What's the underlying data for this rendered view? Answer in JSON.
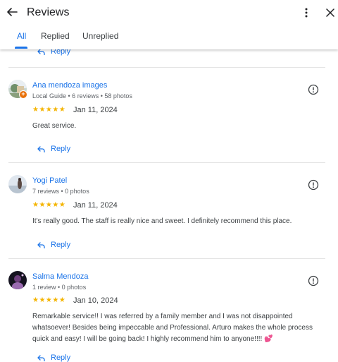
{
  "header": {
    "title": "Reviews",
    "back_icon": "arrow-back-icon",
    "more_icon": "more-vert-icon",
    "close_icon": "close-icon"
  },
  "tabs": [
    {
      "label": "All",
      "active": true
    },
    {
      "label": "Replied",
      "active": false
    },
    {
      "label": "Unreplied",
      "active": false
    }
  ],
  "colors": {
    "accent": "#1a73e8",
    "star": "#f4b400",
    "badge": "#e8710a"
  },
  "reply_label": "Reply",
  "reviews": [
    {
      "name": "Ana mendoza images",
      "meta": "Local Guide • 6 reviews • 58 photos",
      "stars": "★★★★★",
      "rating": 5,
      "date": "Jan 11, 2024",
      "text": "Great service.",
      "local_guide": true
    },
    {
      "name": "Yogi Patel",
      "meta": "7 reviews • 0 photos",
      "stars": "★★★★★",
      "rating": 5,
      "date": "Jan 11, 2024",
      "text": "It's really good. The staff is really nice and sweet. I definitely recommend this place."
    },
    {
      "name": "Salma Mendoza",
      "meta": "1 review • 0 photos",
      "stars": "★★★★★",
      "rating": 5,
      "date": "Jan 10, 2024",
      "text": "Remarkable service!! I was referred by a family member and I was not disappointed whatsoever! Besides being impeccable and Professional. Arturo makes the whole process quick and easy! I will be going back! I highly recommend him to anyone!!!! 💕"
    }
  ]
}
